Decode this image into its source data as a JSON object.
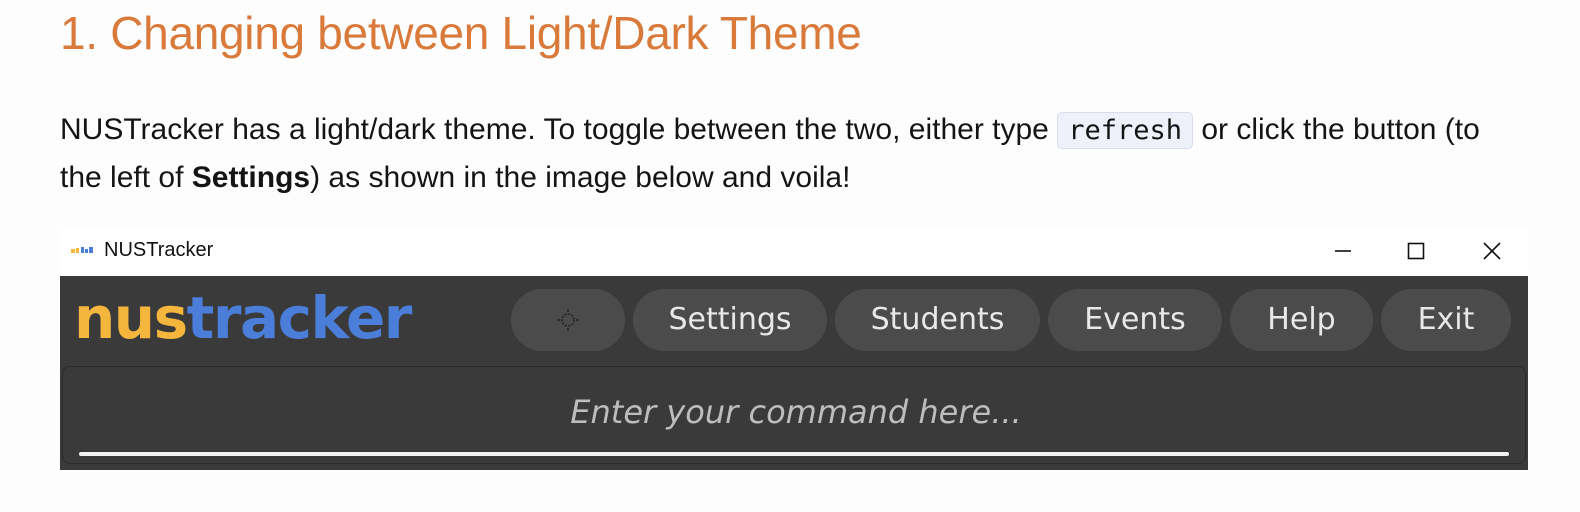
{
  "doc": {
    "heading": "1. Changing between Light/Dark Theme",
    "para_part1": "NUSTracker has a light/dark theme. To toggle between the two, either type ",
    "code": "refresh",
    "para_part2": " or click the button (to the left of ",
    "para_bold": "Settings",
    "para_part3": ") as shown in the image below and voila!"
  },
  "window": {
    "title": "NUSTracker",
    "controls": [
      "minimize-icon",
      "maximize-icon",
      "close-icon"
    ]
  },
  "app": {
    "logo_part1": "nus",
    "logo_part2": "tracker",
    "nav": {
      "theme_icon": "sun-icon",
      "settings": "Settings",
      "students": "Students",
      "events": "Events",
      "help": "Help",
      "exit": "Exit"
    },
    "command": {
      "placeholder": "Enter your command here...",
      "value": ""
    }
  },
  "colors": {
    "heading": "#d97a3a",
    "logo_nus": "#f4b63d",
    "logo_tracker": "#4a7ed9",
    "app_bg": "#3a3a3a",
    "button_bg": "#4b4b4b"
  }
}
